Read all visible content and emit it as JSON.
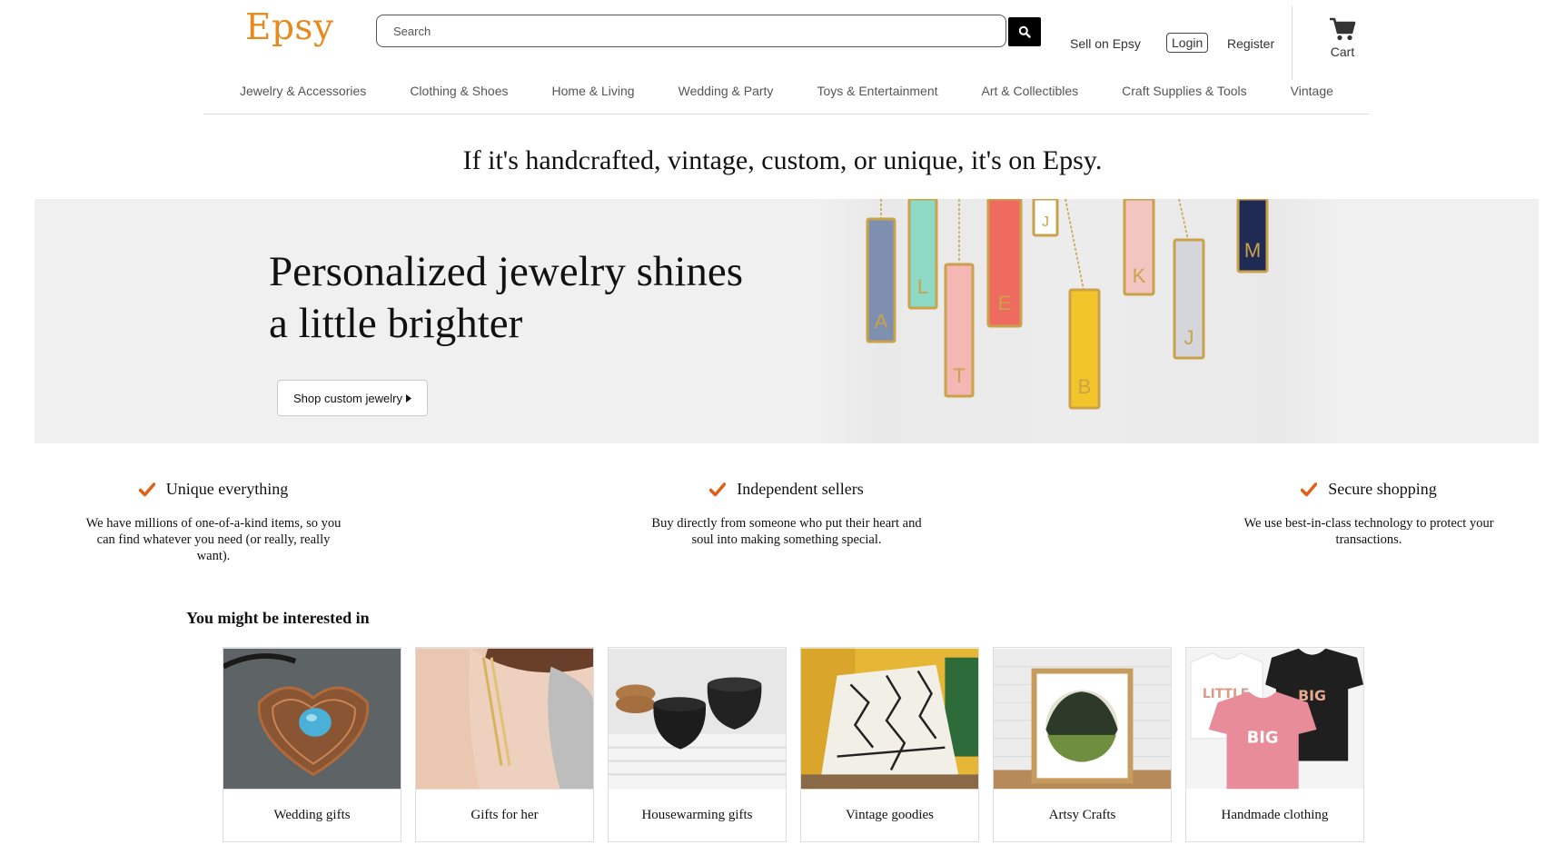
{
  "header": {
    "logo": "Epsy",
    "search_placeholder": "Search",
    "sell_label": "Sell on Epsy",
    "login_label": "Login",
    "register_label": "Register",
    "cart_label": "Cart"
  },
  "categories": [
    "Jewelry & Accessories",
    "Clothing & Shoes",
    "Home & Living",
    "Wedding & Party",
    "Toys & Entertainment",
    "Art & Collectibles",
    "Craft Supplies & Tools",
    "Vintage"
  ],
  "tagline": "If it's handcrafted, vintage, custom, or unique, it's on Epsy.",
  "hero": {
    "title_line1": "Personalized jewelry shines",
    "title_line2": "a little brighter",
    "button_label": "Shop custom jewelry",
    "pendant_letters": [
      "A",
      "L",
      "T",
      "E",
      "J",
      "B",
      "K",
      "J",
      "M"
    ]
  },
  "features": [
    {
      "title": "Unique everything",
      "text": "We have millions of one-of-a-kind items, so you can find whatever you need (or really, really want)."
    },
    {
      "title": "Independent sellers",
      "text": "Buy directly from someone who put their heart and soul into making something special."
    },
    {
      "title": "Secure shopping",
      "text": "We use best-in-class technology to protect your transactions."
    }
  ],
  "interested": {
    "heading": "You might be interested in",
    "cards": [
      {
        "label": "Wedding gifts"
      },
      {
        "label": "Gifts for her"
      },
      {
        "label": "Housewarming gifts"
      },
      {
        "label": "Vintage goodies"
      },
      {
        "label": "Artsy Crafts"
      },
      {
        "label": "Handmade clothing",
        "shirt_texts": [
          "LITTLE",
          "BIG",
          "BIG"
        ]
      }
    ]
  },
  "colors": {
    "brand": "#e58a1f",
    "check": "#e0601a",
    "hero_bg": "#f0f0f0"
  }
}
